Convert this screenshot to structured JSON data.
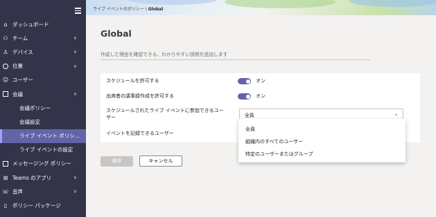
{
  "sidebar": {
    "items": [
      {
        "label": "ダッシュボード",
        "icon": "home-icon",
        "chevron": ""
      },
      {
        "label": "チーム",
        "icon": "teams-icon",
        "chevron": "∨"
      },
      {
        "label": "デバイス",
        "icon": "device-icon",
        "chevron": "∨"
      },
      {
        "label": "位置",
        "icon": "globe-icon",
        "chevron": "∨"
      },
      {
        "label": "ユーザー",
        "icon": "users-icon",
        "chevron": ""
      },
      {
        "label": "会議",
        "icon": "calendar-icon",
        "chevron": "∧"
      },
      {
        "label": "会議ポリシー",
        "icon": "",
        "chevron": ""
      },
      {
        "label": "会議設定",
        "icon": "",
        "chevron": ""
      },
      {
        "label": "ライブ イベント ポリシ...",
        "icon": "",
        "chevron": ""
      },
      {
        "label": "ライブ イベントの設定",
        "icon": "",
        "chevron": ""
      },
      {
        "label": "メッセージング ポリシー",
        "icon": "chat-icon",
        "chevron": ""
      },
      {
        "label": "Teams のアプリ",
        "icon": "apps-icon",
        "chevron": "∨"
      },
      {
        "label": "音声",
        "icon": "phone-icon",
        "chevron": "∨"
      },
      {
        "label": "ポリシー パッケージ",
        "icon": "package-icon",
        "chevron": ""
      }
    ]
  },
  "breadcrumb": {
    "path": "ライブ イベントのポリシー \\ ",
    "current": "Global"
  },
  "main": {
    "title": "Global",
    "description_placeholder": "作成した理由を確認できる、わかりやすい説明を追加します",
    "settings": {
      "allow_scheduling_label": "スケジュールを許可する",
      "allow_scheduling_state": "オン",
      "allow_transcription_label": "出席者の議事録作成を許可する",
      "allow_transcription_state": "オン",
      "who_can_join_label": "スケジュールされたライブ イベントに参加できるユーザー",
      "who_can_join_value": "全員",
      "who_can_record_label": "イベントを記録できるユーザー"
    },
    "dropdown_options": [
      "全員",
      "組織内のすべてのユーザー",
      "特定のユーザーまたはグループ"
    ],
    "buttons": {
      "save": "保存",
      "cancel": "キャンセル"
    }
  },
  "colors": {
    "accent": "#6264a7",
    "sidebar": "#33344a"
  }
}
